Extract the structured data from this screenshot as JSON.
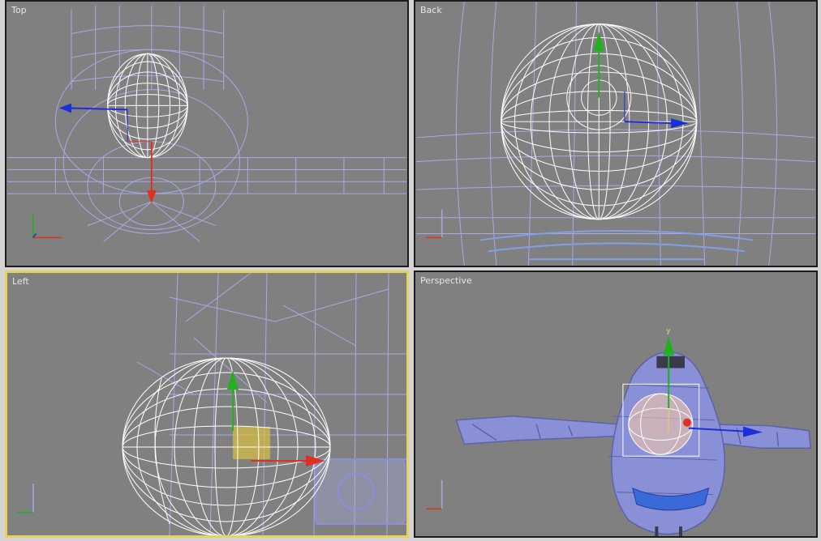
{
  "viewports": {
    "top": {
      "label": "Top",
      "active": false
    },
    "back": {
      "label": "Back",
      "active": false
    },
    "left": {
      "label": "Left",
      "active": true
    },
    "perspective": {
      "label": "Perspective",
      "active": false
    }
  },
  "gizmo": {
    "y_label": "y"
  },
  "colors": {
    "viewport_bg": "#808080",
    "active_border": "#e8d25a",
    "wire_white": "#ffffff",
    "wire_blue": "#a9a9e6",
    "axis_red": "#e03020",
    "axis_green": "#20b020",
    "axis_blue": "#1a2fd8",
    "model_blue": "#8a90d8"
  },
  "icons": [
    "axis-tripod-icon",
    "move-gizmo-icon"
  ]
}
